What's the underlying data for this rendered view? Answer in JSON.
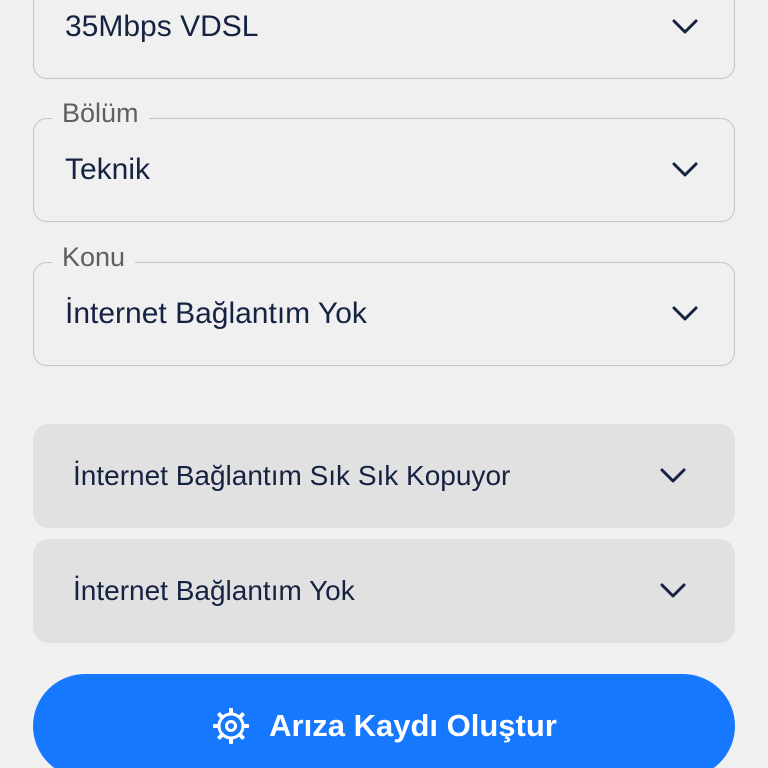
{
  "colors": {
    "background": "#f0f0f0",
    "accent": "#1677ff",
    "field_text": "#152242",
    "label_text": "#5f5f5f",
    "accordion_background": "#e1e1e1"
  },
  "form": {
    "package": {
      "value": "35Mbps VDSL"
    },
    "department": {
      "label": "Bölüm",
      "value": "Teknik"
    },
    "topic": {
      "label": "Konu",
      "value": "İnternet Bağlantım Yok"
    }
  },
  "faq": {
    "items": [
      {
        "label": "İnternet Bağlantım Sık Sık Kopuyor",
        "icon": "chevron-down-icon"
      },
      {
        "label": "İnternet Bağlantım Yok",
        "icon": "chevron-down-icon"
      }
    ]
  },
  "actions": {
    "create_ticket_label": "Arıza Kaydı Oluştur",
    "create_ticket_icon": "gear-icon"
  }
}
